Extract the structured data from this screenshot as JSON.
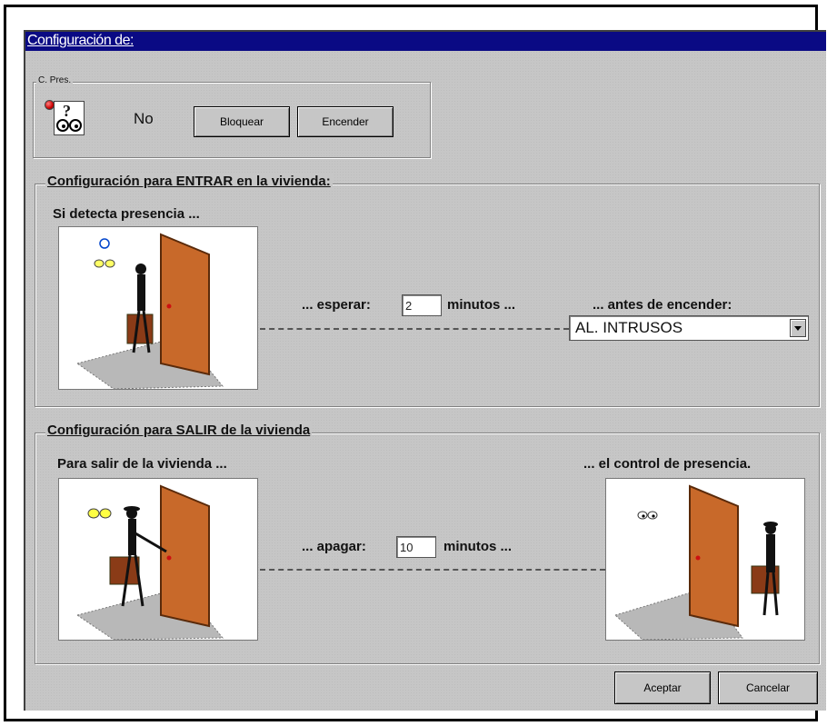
{
  "window": {
    "title": "Configuración de:"
  },
  "presence": {
    "legend": "C. Pres.",
    "status": "No",
    "lock_label": "Bloquear",
    "turn_on_label": "Encender"
  },
  "enter": {
    "legend": "Configuración para ENTRAR en la vivienda:",
    "detect_label": "Si detecta presencia ...",
    "wait_label": "... esperar:",
    "wait_value": "2",
    "minutes_label": "minutos ...",
    "before_label": "... antes de encender:",
    "select_value": "AL. INTRUSOS"
  },
  "exit": {
    "legend": "Configuración para SALIR de la vivienda",
    "leave_label": "Para salir de la vivienda ...",
    "turn_off_label": "... apagar:",
    "turn_off_value": "10",
    "minutes_label": "minutos ...",
    "control_label": "... el control de presencia."
  },
  "footer": {
    "accept_label": "Aceptar",
    "cancel_label": "Cancelar"
  },
  "colors": {
    "title_bar": "#0a0a84",
    "window_bg": "#c6c6c6",
    "door": "#c8692a",
    "indicator": "#cc1111"
  }
}
